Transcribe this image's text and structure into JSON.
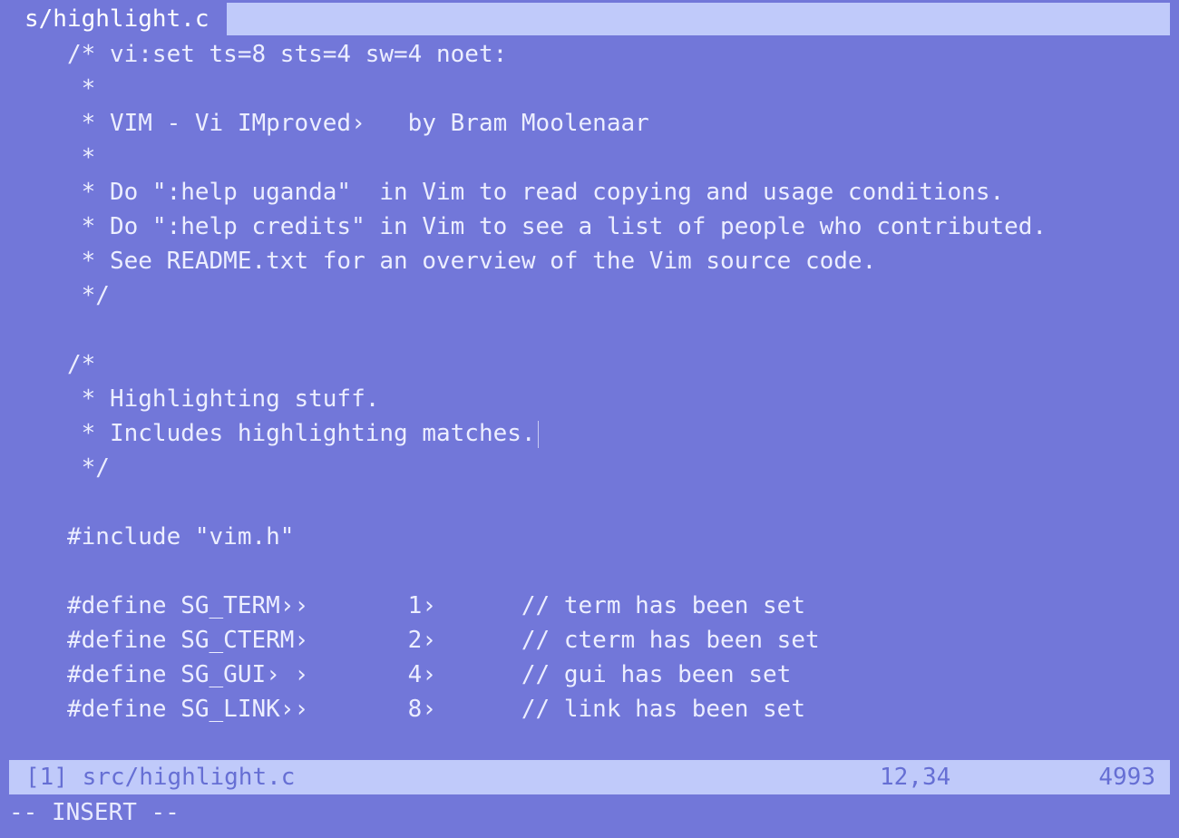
{
  "tabline": {
    "label": "s/highlight.c"
  },
  "buffer": {
    "lines": [
      "/* vi:set ts=8 sts=4 sw=4 noet:",
      " *",
      " * VIM - Vi IMproved›   by Bram Moolenaar",
      " *",
      " * Do \":help uganda\"  in Vim to read copying and usage conditions.",
      " * Do \":help credits\" in Vim to see a list of people who contributed.",
      " * See README.txt for an overview of the Vim source code.",
      " */",
      "",
      "/*",
      " * Highlighting stuff.",
      " * Includes highlighting matches.",
      " */",
      "",
      "#include \"vim.h\"",
      "",
      "#define SG_TERM››       1›      // term has been set",
      "#define SG_CTERM›       2›      // cterm has been set",
      "#define SG_GUI› ›       4›      // gui has been set",
      "#define SG_LINK››       8›      // link has been set"
    ]
  },
  "statusline": {
    "file": "[1] src/highlight.c",
    "position": "12,34",
    "line_count": "4993"
  },
  "modeline": {
    "mode": "-- INSERT --"
  }
}
